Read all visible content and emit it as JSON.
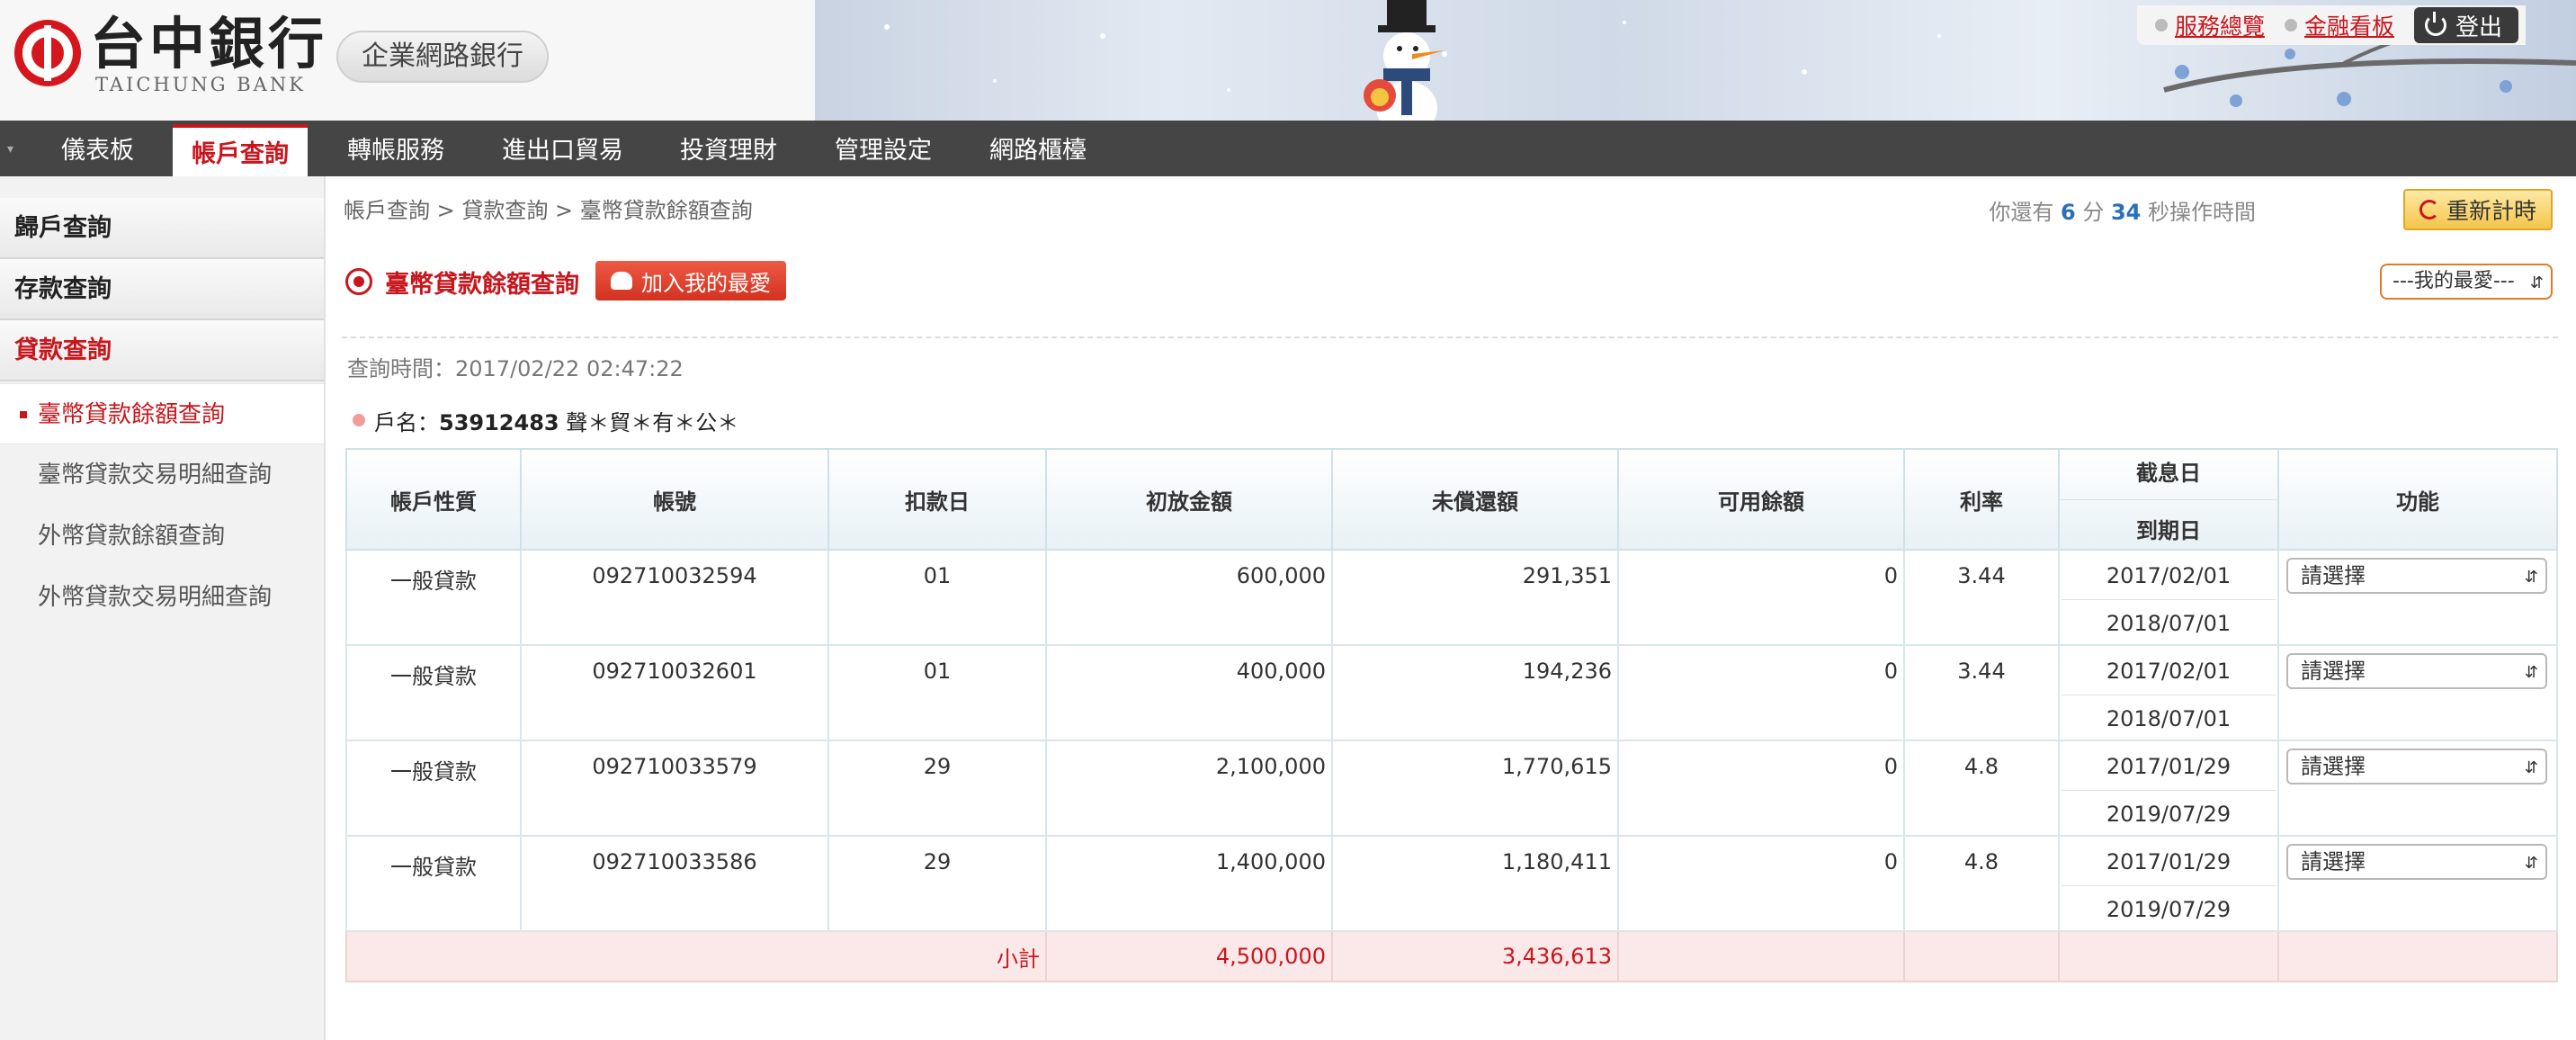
{
  "brand": {
    "name": "台中銀行",
    "name_en": "TAICHUNG BANK",
    "service": "企業網路銀行",
    "accent_color": "#c8161d"
  },
  "top_links": [
    {
      "label": "服務總覽"
    },
    {
      "label": "金融看板"
    }
  ],
  "logout_label": "登出",
  "nav": {
    "items": [
      {
        "label": "儀表板",
        "active": false
      },
      {
        "label": "帳戶查詢",
        "active": true
      },
      {
        "label": "轉帳服務",
        "active": false
      },
      {
        "label": "進出口貿易",
        "active": false
      },
      {
        "label": "投資理財",
        "active": false
      },
      {
        "label": "管理設定",
        "active": false
      },
      {
        "label": "網路櫃檯",
        "active": false
      }
    ]
  },
  "sidebar": {
    "sections": [
      {
        "label": "歸戶查詢"
      },
      {
        "label": "存款查詢"
      },
      {
        "label": "貸款查詢",
        "active": true
      }
    ],
    "sub_items": [
      {
        "label": "臺幣貸款餘額查詢",
        "active": true
      },
      {
        "label": "臺幣貸款交易明細查詢"
      },
      {
        "label": "外幣貸款餘額查詢"
      },
      {
        "label": "外幣貸款交易明細查詢"
      }
    ]
  },
  "breadcrumb": "帳戶查詢 > 貸款查詢 > 臺幣貸款餘額查詢",
  "session": {
    "prefix": "你還有",
    "minutes": "6",
    "min_unit": "分",
    "seconds": "34",
    "sec_unit": "秒操作時間",
    "reset_label": "重新計時"
  },
  "page": {
    "title": "臺幣貸款餘額查詢",
    "add_fav_label": "加入我的最愛",
    "fav_select": "---我的最愛---",
    "query_time": "查詢時間：2017/02/22 02:47:22",
    "account_label": "戶名：",
    "account_number": "53912483",
    "account_holder": "聲＊貿＊有＊公＊"
  },
  "table": {
    "headers": {
      "type": "帳戶性質",
      "account": "帳號",
      "deduct_day": "扣款日",
      "initial": "初放金額",
      "unpaid": "未償還額",
      "available": "可用餘額",
      "rate": "利率",
      "interest_date": "截息日",
      "due_date": "到期日",
      "function": "功能"
    },
    "rows": [
      {
        "type": "一般貸款",
        "account": "092710032594",
        "deduct_day": "01",
        "initial": "600,000",
        "unpaid": "291,351",
        "available": "0",
        "rate": "3.44",
        "interest_date": "2017/02/01",
        "due_date": "2018/07/01",
        "action": "請選擇"
      },
      {
        "type": "一般貸款",
        "account": "092710032601",
        "deduct_day": "01",
        "initial": "400,000",
        "unpaid": "194,236",
        "available": "0",
        "rate": "3.44",
        "interest_date": "2017/02/01",
        "due_date": "2018/07/01",
        "action": "請選擇"
      },
      {
        "type": "一般貸款",
        "account": "092710033579",
        "deduct_day": "29",
        "initial": "2,100,000",
        "unpaid": "1,770,615",
        "available": "0",
        "rate": "4.8",
        "interest_date": "2017/01/29",
        "due_date": "2019/07/29",
        "action": "請選擇"
      },
      {
        "type": "一般貸款",
        "account": "092710033586",
        "deduct_day": "29",
        "initial": "1,400,000",
        "unpaid": "1,180,411",
        "available": "0",
        "rate": "4.8",
        "interest_date": "2017/01/29",
        "due_date": "2019/07/29",
        "action": "請選擇"
      }
    ],
    "subtotal": {
      "label": "小計",
      "initial": "4,500,000",
      "unpaid": "3,436,613"
    }
  }
}
